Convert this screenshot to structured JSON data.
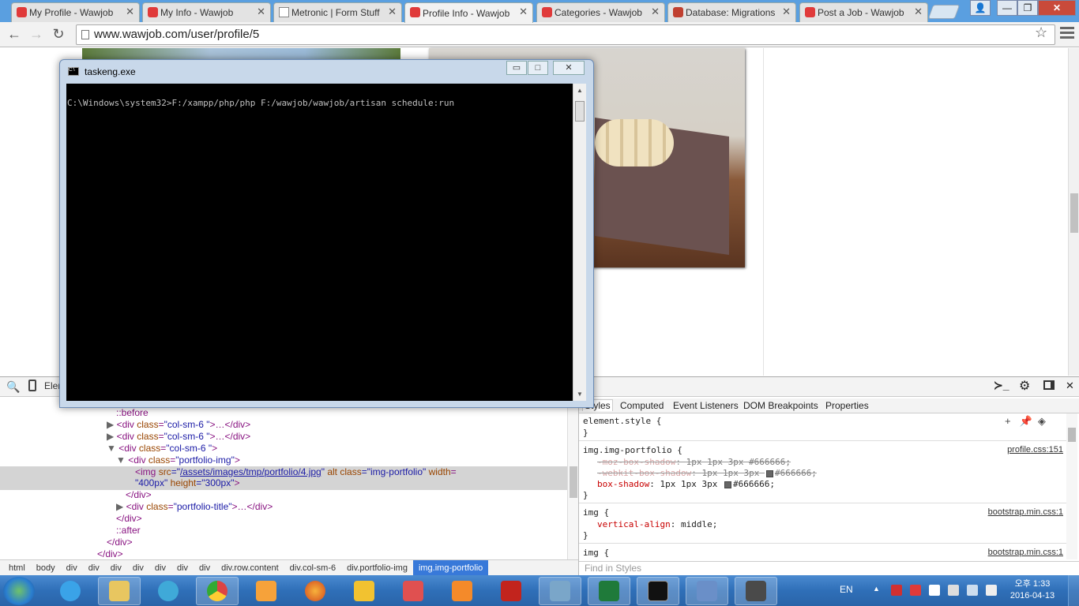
{
  "browser": {
    "tabs": [
      {
        "label": "My Profile - Wawjob",
        "icon": "wawjob-icon"
      },
      {
        "label": "My Info - Wawjob",
        "icon": "wawjob-icon"
      },
      {
        "label": "Metronic | Form Stuff",
        "icon": "page-icon"
      },
      {
        "label": "Profile Info - Wawjob",
        "icon": "wawjob-icon",
        "active": true
      },
      {
        "label": "Categories - Wawjob",
        "icon": "wawjob-icon"
      },
      {
        "label": "Database: Migrations",
        "icon": "laravel-icon"
      },
      {
        "label": "Post a Job - Wawjob",
        "icon": "wawjob-icon"
      }
    ],
    "url": "www.wawjob.com/user/profile/5"
  },
  "console": {
    "title": "taskeng.exe",
    "command": "C:\\Windows\\system32>F:/xampp/php/php F:/wawjob/wawjob/artisan schedule:run",
    "min": "▭",
    "max": "□",
    "close": "✕"
  },
  "devtools": {
    "elements_tab": "Elements",
    "dom": [
      {
        "ps": "::before"
      },
      {
        "tri": "▶",
        "tag_open": "<div ",
        "an": "class",
        "av": "\"col-sm-6 \"",
        "rest": ">…</div>"
      },
      {
        "tri": "▶",
        "tag_open": "<div ",
        "an": "class",
        "av": "\"col-sm-6 \"",
        "rest": ">…</div>"
      },
      {
        "tri": "▼",
        "tag_open": "<div ",
        "an": "class",
        "av": "\"col-sm-6 \"",
        "rest": ">"
      },
      {
        "tri": "▼",
        "tag_open": "<div ",
        "an": "class",
        "av": "\"portfolio-img\"",
        "rest": ">"
      },
      {
        "img1": "<img ",
        "an1": "src",
        "eq": "=\"",
        "link": "/assets/images/tmp/portfolio/4.jpg",
        "q": "\" ",
        "an2": "alt",
        "sp": " ",
        "an3": "class",
        "av3": "=\"img-portfolio\"",
        "sp2": " ",
        "an4": "width",
        "eq4": "="
      },
      {
        "av5": "\"400px\"",
        "sp": " ",
        "an6": "height",
        "av6": "=\"300px\"",
        "close": ">"
      },
      {
        "tag": "</div>"
      },
      {
        "tri": "▶",
        "tag_open": "<div ",
        "an": "class",
        "av": "\"portfolio-title\"",
        "rest": ">…</div>"
      },
      {
        "tag": "</div>"
      },
      {
        "ps": "::after"
      },
      {
        "tag": "</div>"
      },
      {
        "tag": "</div>"
      }
    ],
    "breadcrumbs": [
      "html",
      "body",
      "div",
      "div",
      "div",
      "div",
      "div",
      "div",
      "div",
      "div.row.content",
      "div.col-sm-6",
      "div.portfolio-img",
      "img.img-portfolio"
    ],
    "style_tabs": [
      "Styles",
      "Computed",
      "Event Listeners",
      "DOM Breakpoints",
      "Properties"
    ],
    "styles": {
      "element_style": "element.style {",
      "close_brace": "}",
      "rule1_selector": "img.img-portfolio {",
      "rule1_source": "profile.css:151",
      "rule1_props": [
        {
          "name": "-moz-box-shadow",
          "value": "1px 1px 3px #666666;",
          "struck": true
        },
        {
          "name": "-webkit-box-shadow",
          "value": "1px 1px 3px",
          "value2": "#666666;",
          "struck": true
        },
        {
          "name": "box-shadow",
          "value": "1px 1px 3px",
          "value2": "#666666;",
          "struck": false
        }
      ],
      "rule2_selector": "img {",
      "rule2_source": "bootstrap.min.css:1",
      "rule2_prop": "vertical-align",
      "rule2_value": "middle;",
      "rule3_selector": "img {",
      "rule3_source": "bootstrap.min.css:1",
      "find_placeholder": "Find in Styles"
    }
  },
  "taskbar": {
    "language": "EN",
    "time": "오후 1:33",
    "date": "2016-04-13",
    "apps": [
      "ie-icon",
      "explorer-icon",
      "media-icon",
      "chrome-icon",
      "video-icon",
      "firefox-icon",
      "app-icon",
      "eraser-icon",
      "xampp-icon",
      "filezilla-icon",
      "photo-icon",
      "excel-icon",
      "cmd-icon",
      "dolphin-icon",
      "sublime-icon"
    ]
  },
  "colors": {
    "titlebar": "#5a9fe0",
    "taskbar": "#2f6fb8",
    "selected_crumb": "#3879d9"
  }
}
